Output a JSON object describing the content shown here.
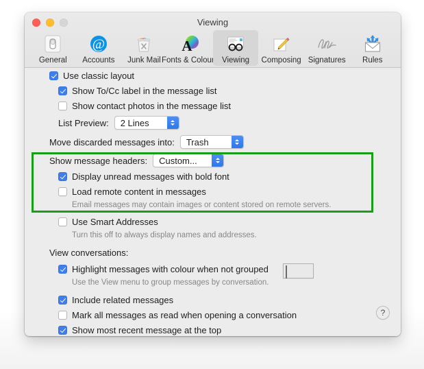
{
  "window": {
    "title": "Viewing",
    "traffic_lights": [
      "close",
      "minimize",
      "zoom"
    ]
  },
  "toolbar": {
    "items": [
      {
        "label": "General",
        "icon": "general-switch-icon",
        "selected": false
      },
      {
        "label": "Accounts",
        "icon": "at-sign-icon",
        "selected": false
      },
      {
        "label": "Junk Mail",
        "icon": "trash-x-icon",
        "selected": false
      },
      {
        "label": "Fonts & Colours",
        "icon": "font-colorwheel-icon",
        "selected": false
      },
      {
        "label": "Viewing",
        "icon": "glasses-message-icon",
        "selected": true
      },
      {
        "label": "Composing",
        "icon": "pencil-note-icon",
        "selected": false
      },
      {
        "label": "Signatures",
        "icon": "signature-icon",
        "selected": false
      },
      {
        "label": "Rules",
        "icon": "envelope-arrows-icon",
        "selected": false
      }
    ]
  },
  "settings": {
    "use_classic_layout": {
      "label": "Use classic layout",
      "checked": true
    },
    "show_tocc_label": {
      "label": "Show To/Cc label in the message list",
      "checked": true
    },
    "show_contact_photos": {
      "label": "Show contact photos in the message list",
      "checked": false
    },
    "list_preview": {
      "label": "List Preview:",
      "value": "2 Lines"
    },
    "move_discarded": {
      "label": "Move discarded messages into:",
      "value": "Trash"
    },
    "show_message_headers": {
      "label": "Show message headers:",
      "value": "Custom..."
    },
    "display_unread_bold": {
      "label": "Display unread messages with bold font",
      "checked": true
    },
    "load_remote_content": {
      "label": "Load remote content in messages",
      "checked": false
    },
    "load_remote_content_help": "Email messages may contain images or content stored on remote servers.",
    "use_smart_addresses": {
      "label": "Use Smart Addresses",
      "checked": false
    },
    "use_smart_addresses_help": "Turn this off to always display names and addresses.",
    "view_conversations_label": "View conversations:",
    "highlight_messages": {
      "label": "Highlight messages with colour when not grouped",
      "checked": true
    },
    "highlight_messages_help": "Use the View menu to group messages by conversation.",
    "highlight_colour": "#c4d7ec",
    "include_related": {
      "label": "Include related messages",
      "checked": true
    },
    "mark_all_read": {
      "label": "Mark all messages as read when opening a conversation",
      "checked": false
    },
    "show_most_recent": {
      "label": "Show most recent message at the top",
      "checked": true
    }
  },
  "help_button": {
    "glyph": "?"
  },
  "annotation": {
    "colour": "#1a9e1a"
  }
}
